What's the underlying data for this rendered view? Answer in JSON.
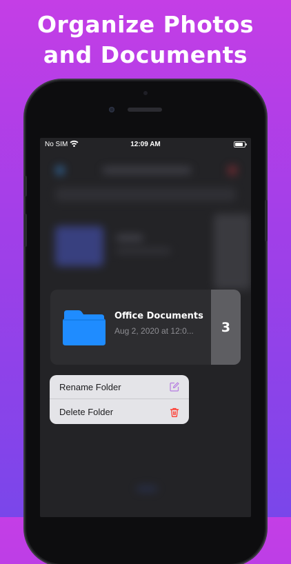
{
  "headline": {
    "line1": "Organize Photos",
    "line2": "and Documents"
  },
  "status_bar": {
    "carrier": "No SIM",
    "time": "12:09 AM"
  },
  "folder_card": {
    "name": "Office Documents",
    "date": "Aug 2, 2020 at 12:0...",
    "count": "3",
    "folder_color": "#1f8cff"
  },
  "context_menu": {
    "items": [
      {
        "label": "Rename Folder",
        "icon": "edit-icon",
        "icon_color": "#b57ae0"
      },
      {
        "label": "Delete Folder",
        "icon": "trash-icon",
        "icon_color": "#ff3b30"
      }
    ]
  },
  "colors": {
    "background_top": "#c43ee6",
    "background_bottom": "#7a46ea",
    "screen_bg": "#232326",
    "card_bg": "#2d2d30",
    "badge_bg": "#5e5e62",
    "menu_bg": "#e4e4e8"
  }
}
